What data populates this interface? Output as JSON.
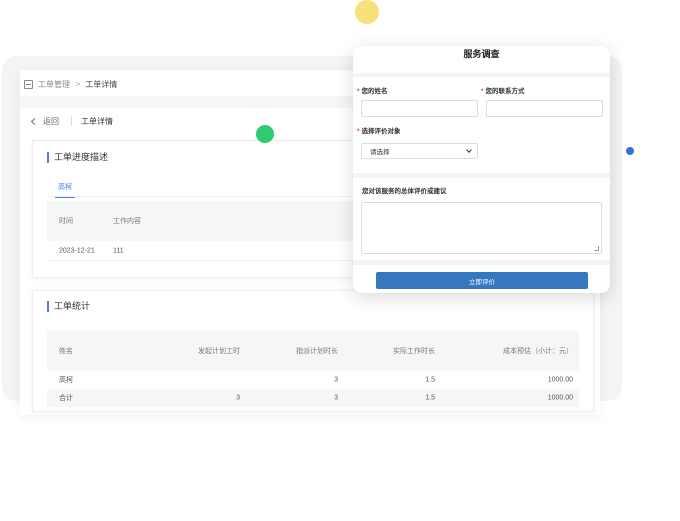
{
  "breadcrumb": {
    "root": "工单管理",
    "separator": ">",
    "current": "工单详情"
  },
  "sub_header": {
    "back_label": "返回",
    "title": "工单详情"
  },
  "progress_section": {
    "title": "工单进度描述",
    "tab_label": "高柯",
    "columns": [
      "时间",
      "工作内容"
    ],
    "rows": [
      {
        "time": "2023-12-21",
        "content": "111"
      }
    ]
  },
  "stats_section": {
    "title": "工单统计",
    "columns": [
      "姓名",
      "发起计划工时",
      "指派计划时长",
      "实际工作时长",
      "成本预估（小计：元）"
    ],
    "rows": [
      [
        "高柯",
        "",
        "3",
        "1.5",
        "1000.00"
      ],
      [
        "合计",
        "3",
        "3",
        "1.5",
        "1000.00"
      ]
    ]
  },
  "survey": {
    "title": "服务调查",
    "required_mark": "*",
    "name_label": "您的姓名",
    "contact_label": "您的联系方式",
    "target_label": "选择评价对象",
    "target_selected": "请选择",
    "overall_label": "您对该服务的总体评价或建议",
    "submit_label": "立即评价"
  }
}
